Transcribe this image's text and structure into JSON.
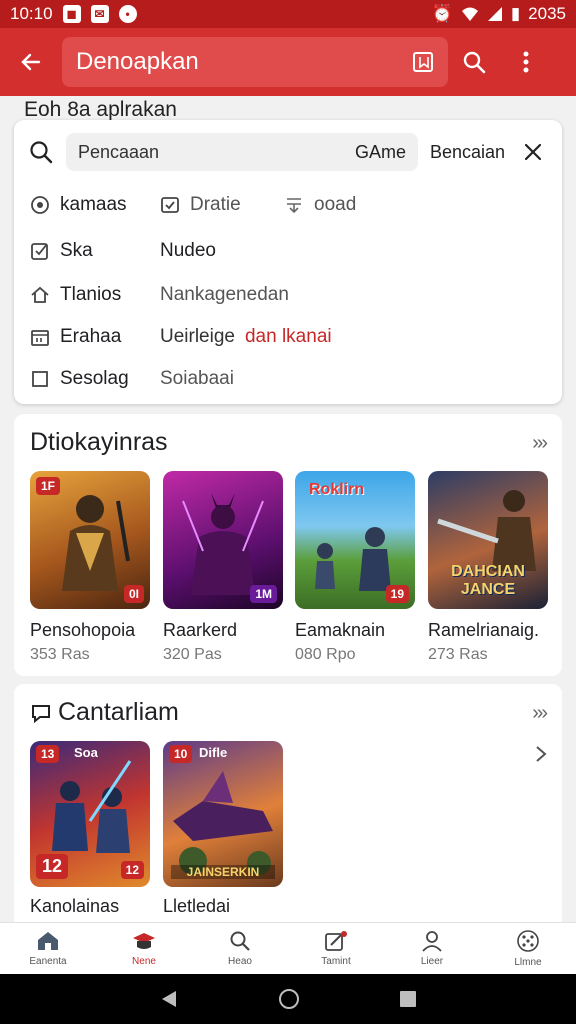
{
  "status_bar": {
    "time": "10:10",
    "battery": "2035"
  },
  "app_bar": {
    "title": "Denoapkan"
  },
  "subtitle": "Eoh 8a aplrakan",
  "search": {
    "placeholder": "Pencaaan",
    "category": "GAme",
    "submit_label": "Bencaian"
  },
  "filters": [
    {
      "icon": "compass-icon",
      "label": "kamaas"
    },
    {
      "icon": "checkbox-icon",
      "label": "Dratie"
    },
    {
      "icon": "download-icon",
      "label": "ooad"
    },
    {
      "icon": "check-square-icon",
      "label": "Ska"
    },
    {
      "label": "Nudeo"
    },
    {
      "icon": "home-icon",
      "label": "Tlanios"
    },
    {
      "label": "Nankagenedan"
    },
    {
      "icon": "calendar-icon",
      "label": "Erahaa"
    },
    {
      "label": "Ueirleige",
      "highlight": "dan lkanai"
    },
    {
      "icon": "square-icon",
      "label": "Sesolag"
    },
    {
      "label": "Soiabaai"
    }
  ],
  "section1": {
    "title": "Dtiokayinras",
    "more": "»›",
    "apps": [
      {
        "name": "Pensohopoia",
        "size": "353 Ras",
        "badge": "1F",
        "corner": "0I",
        "art": "knight-icon"
      },
      {
        "name": "Raarkerd",
        "size": "320 Pas",
        "badge": "",
        "corner": "1M",
        "art": "demon-icon"
      },
      {
        "name": "Eamaknain",
        "size": "080 Rpo",
        "badge": "",
        "corner": "19",
        "art": "battle-icon",
        "banner": "Roklirn"
      },
      {
        "name": "Ramelrianaig.",
        "size": "273 Ras",
        "badge": "",
        "corner": "",
        "art": "soldier-icon",
        "banner": "DAHCIAN JANCE"
      }
    ]
  },
  "section2": {
    "title": "Cantarliam",
    "more": "»›",
    "apps": [
      {
        "name": "Kanolainas",
        "badge": "13",
        "top_label": "Soa",
        "number": "12",
        "corner": "12",
        "art": "warriors-icon"
      },
      {
        "name": "Lletledai",
        "badge": "10",
        "top_label": "Difle",
        "banner": "JAINSERKIN",
        "art": "ship-icon"
      }
    ]
  },
  "bottom_nav": [
    {
      "label": "Eanenta",
      "icon": "home-icon",
      "active": false
    },
    {
      "label": "Nene",
      "icon": "cap-icon",
      "active": true
    },
    {
      "label": "Heao",
      "icon": "search-icon",
      "active": false
    },
    {
      "label": "Tamint",
      "icon": "edit-icon",
      "active": false
    },
    {
      "label": "Lieer",
      "icon": "person-icon",
      "active": false
    },
    {
      "label": "Llmne",
      "icon": "grid-icon",
      "active": false
    }
  ],
  "colors": {
    "primary": "#d32f2f",
    "status": "#b71c1c",
    "accent": "#c62828"
  }
}
